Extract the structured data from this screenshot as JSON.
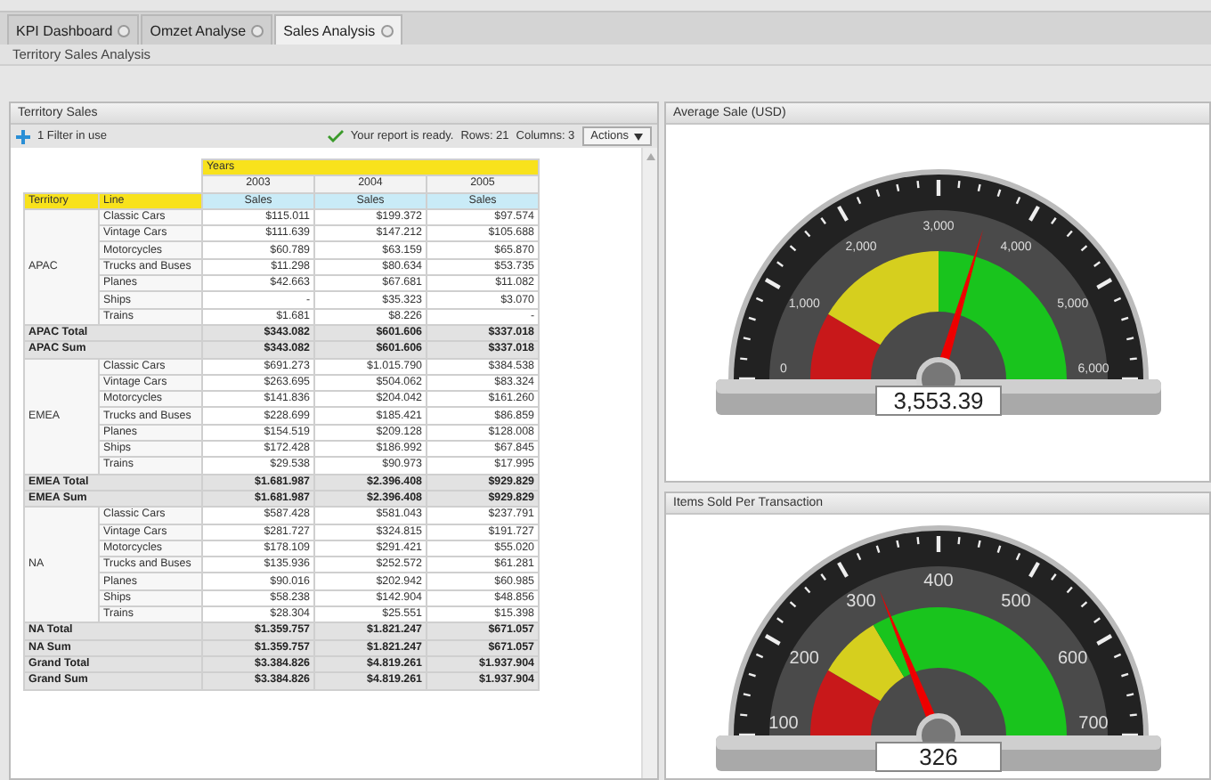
{
  "tabs": [
    {
      "label": "KPI Dashboard",
      "selected": false
    },
    {
      "label": "Omzet Analyse",
      "selected": false
    },
    {
      "label": "Sales Analysis",
      "selected": true
    }
  ],
  "page_title": "Territory Sales Analysis",
  "report": {
    "title": "Territory Sales",
    "filter": "1 Filter in use",
    "status": "Your report is ready.",
    "rows": "Rows: 21",
    "columns": "Columns: 3",
    "actions": "Actions",
    "dimension_header": "Years",
    "years": [
      "2003",
      "2004",
      "2005"
    ],
    "measures": [
      "Sales",
      "Sales",
      "Sales"
    ],
    "row_headers": [
      "Territory",
      "Line"
    ],
    "groups": [
      {
        "territory": "APAC",
        "rows": [
          {
            "line": "Classic Cars",
            "values": [
              "$115.011",
              "$199.372",
              "$97.574"
            ]
          },
          {
            "line": "Vintage Cars",
            "values": [
              "$111.639",
              "$147.212",
              "$105.688"
            ]
          },
          {
            "line": "Motorcycles",
            "values": [
              "$60.789",
              "$63.159",
              "$65.870"
            ]
          },
          {
            "line": "Trucks and Buses",
            "values": [
              "$11.298",
              "$80.634",
              "$53.735"
            ]
          },
          {
            "line": "Planes",
            "values": [
              "$42.663",
              "$67.681",
              "$11.082"
            ]
          },
          {
            "line": "Ships",
            "values": [
              "-",
              "$35.323",
              "$3.070"
            ]
          },
          {
            "line": "Trains",
            "values": [
              "$1.681",
              "$8.226",
              "-"
            ]
          }
        ],
        "totals": [
          {
            "label": "APAC Total",
            "values": [
              "$343.082",
              "$601.606",
              "$337.018"
            ]
          },
          {
            "label": "APAC Sum",
            "values": [
              "$343.082",
              "$601.606",
              "$337.018"
            ]
          }
        ]
      },
      {
        "territory": "EMEA",
        "rows": [
          {
            "line": "Classic Cars",
            "values": [
              "$691.273",
              "$1.015.790",
              "$384.538"
            ]
          },
          {
            "line": "Vintage Cars",
            "values": [
              "$263.695",
              "$504.062",
              "$83.324"
            ]
          },
          {
            "line": "Motorcycles",
            "values": [
              "$141.836",
              "$204.042",
              "$161.260"
            ]
          },
          {
            "line": "Trucks and Buses",
            "values": [
              "$228.699",
              "$185.421",
              "$86.859"
            ]
          },
          {
            "line": "Planes",
            "values": [
              "$154.519",
              "$209.128",
              "$128.008"
            ]
          },
          {
            "line": "Ships",
            "values": [
              "$172.428",
              "$186.992",
              "$67.845"
            ]
          },
          {
            "line": "Trains",
            "values": [
              "$29.538",
              "$90.973",
              "$17.995"
            ]
          }
        ],
        "totals": [
          {
            "label": "EMEA Total",
            "values": [
              "$1.681.987",
              "$2.396.408",
              "$929.829"
            ]
          },
          {
            "label": "EMEA Sum",
            "values": [
              "$1.681.987",
              "$2.396.408",
              "$929.829"
            ]
          }
        ]
      },
      {
        "territory": "NA",
        "rows": [
          {
            "line": "Classic Cars",
            "values": [
              "$587.428",
              "$581.043",
              "$237.791"
            ]
          },
          {
            "line": "Vintage Cars",
            "values": [
              "$281.727",
              "$324.815",
              "$191.727"
            ]
          },
          {
            "line": "Motorcycles",
            "values": [
              "$178.109",
              "$291.421",
              "$55.020"
            ]
          },
          {
            "line": "Trucks and Buses",
            "values": [
              "$135.936",
              "$252.572",
              "$61.281"
            ]
          },
          {
            "line": "Planes",
            "values": [
              "$90.016",
              "$202.942",
              "$60.985"
            ]
          },
          {
            "line": "Ships",
            "values": [
              "$58.238",
              "$142.904",
              "$48.856"
            ]
          },
          {
            "line": "Trains",
            "values": [
              "$28.304",
              "$25.551",
              "$15.398"
            ]
          }
        ],
        "totals": [
          {
            "label": "NA Total",
            "values": [
              "$1.359.757",
              "$1.821.247",
              "$671.057"
            ]
          },
          {
            "label": "NA Sum",
            "values": [
              "$1.359.757",
              "$1.821.247",
              "$671.057"
            ]
          }
        ]
      }
    ],
    "grand": [
      {
        "label": "Grand Total",
        "values": [
          "$3.384.826",
          "$4.819.261",
          "$1.937.904"
        ]
      },
      {
        "label": "Grand Sum",
        "values": [
          "$3.384.826",
          "$4.819.261",
          "$1.937.904"
        ]
      }
    ]
  },
  "gauges": [
    {
      "title": "Average Sale (USD)",
      "scale": [
        "0",
        "1,000",
        "2,000",
        "3,000",
        "4,000",
        "5,000",
        "6,000"
      ],
      "level": 0.592,
      "reading": "3,553.39"
    },
    {
      "title": "Items Sold Per Transaction",
      "scale": [
        "100",
        "200",
        "300",
        "400",
        "500",
        "600",
        "700"
      ],
      "level": 0.377,
      "reading": "326"
    }
  ]
}
